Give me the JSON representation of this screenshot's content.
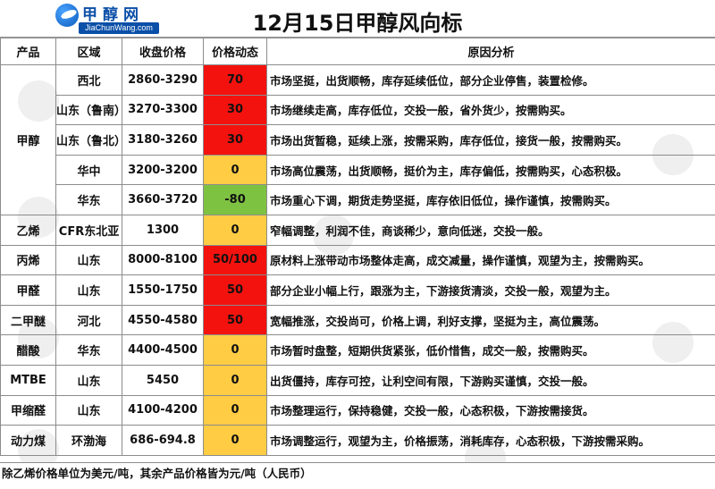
{
  "header": {
    "logo_cn": "甲醇网",
    "logo_en": "JiaChunWang.com",
    "title": "12月15日甲醇风向标"
  },
  "columns": [
    "产品",
    "区域",
    "收盘价格",
    "价格动态",
    "原因分析"
  ],
  "rows": [
    {
      "product": "甲醇",
      "region": "西北",
      "price": "2860-3290",
      "change": "70",
      "signal": "red",
      "reason": "市场坚挺，出货顺畅，库存延续低位，部分企业停售，装置检修。"
    },
    {
      "product": "",
      "region": "山东（鲁南）",
      "price": "3270-3300",
      "change": "30",
      "signal": "red",
      "reason": "市场继续走高，库存低位，交投一般，省外货少，按需购买。"
    },
    {
      "product": "",
      "region": "山东（鲁北）",
      "price": "3180-3260",
      "change": "30",
      "signal": "red",
      "reason": "市场出货暂稳，延续上涨，按需采购，库存低位，接货一般，按需购买。"
    },
    {
      "product": "",
      "region": "华中",
      "price": "3200-3200",
      "change": "0",
      "signal": "yellow",
      "reason": "市场高位震荡，出货顺畅，挺价为主，库存偏低，按需购买，心态积极。"
    },
    {
      "product": "",
      "region": "华东",
      "price": "3660-3720",
      "change": "-80",
      "signal": "green",
      "reason": "市场重心下调，期货走势坚挺，库存依旧低位，操作谨慎，按需购买。"
    },
    {
      "product": "乙烯",
      "region": "CFR东北亚",
      "price": "1300",
      "change": "0",
      "signal": "yellow",
      "reason": "窄幅调整，利润不佳，商谈稀少，意向低迷，交投一般。"
    },
    {
      "product": "丙烯",
      "region": "山东",
      "price": "8000-8100",
      "change": "50/100",
      "signal": "red",
      "reason": "原材料上涨带动市场整体走高，成交减量，操作谨慎，观望为主，按需购买。"
    },
    {
      "product": "甲醛",
      "region": "山东",
      "price": "1550-1750",
      "change": "50",
      "signal": "red",
      "reason": "部分企业小幅上行，跟涨为主，下游接货清淡，交投一般，观望为主。"
    },
    {
      "product": "二甲醚",
      "region": "河北",
      "price": "4550-4580",
      "change": "50",
      "signal": "red",
      "reason": "宽幅推涨，交投尚可，价格上调，利好支撑，坚挺为主，高位震荡。"
    },
    {
      "product": "醋酸",
      "region": "华东",
      "price": "4400-4500",
      "change": "0",
      "signal": "yellow",
      "reason": "市场暂时盘整，短期供货紧张，低价惜售，成交一般，按需购买。"
    },
    {
      "product": "MTBE",
      "region": "山东",
      "price": "5450",
      "change": "0",
      "signal": "yellow",
      "reason": "出货僵持，库存可控，让利空间有限，下游购买谨慎，交投一般。"
    },
    {
      "product": "甲缩醛",
      "region": "山东",
      "price": "4100-4200",
      "change": "0",
      "signal": "yellow",
      "reason": "市场整理运行，保持稳健，交投一般，心态积极，下游按需接货。"
    },
    {
      "product": "动力煤",
      "region": "环渤海",
      "price": "686-694.8",
      "change": "0",
      "signal": "yellow",
      "reason": "市场调整运行，观望为主，价格振荡，消耗库存，心态积极，下游按需采购。"
    }
  ],
  "footer": {
    "note": "除乙烯价格单位为美元/吨，其余产品价格皆为元/吨（人民币）"
  },
  "colors": {
    "red": "#f4120e",
    "yellow": "#ffcc44",
    "green": "#7ec242",
    "brand": "#0a4fa8"
  }
}
